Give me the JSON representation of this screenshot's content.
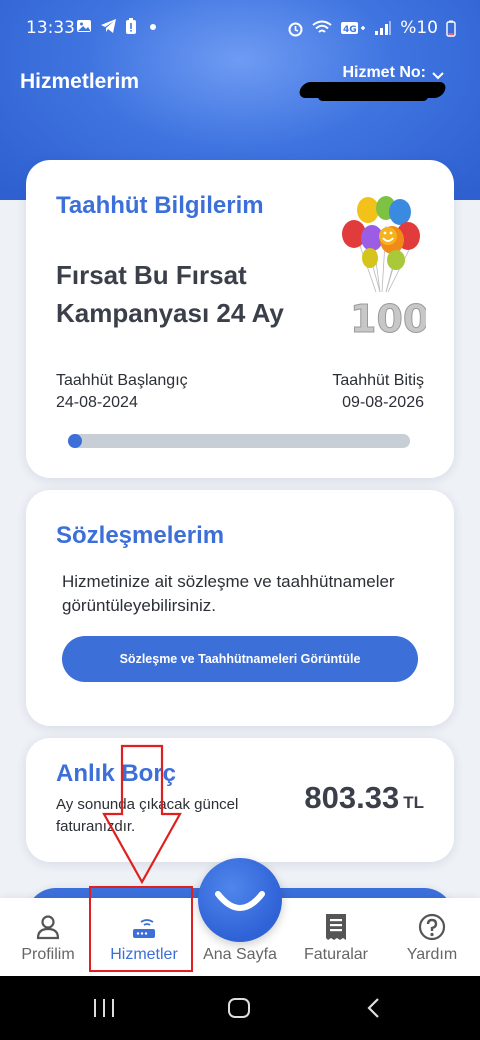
{
  "status_bar": {
    "time": "13:33",
    "battery_text": "%10",
    "left_icons": [
      "gallery-icon",
      "telegram-icon",
      "battery-alert-icon",
      "dot-icon"
    ],
    "right_icons": [
      "alarm-icon",
      "wifi-icon",
      "signal-icon"
    ]
  },
  "header": {
    "title": "Hizmetlerim",
    "service_no_label": "Hizmet No:"
  },
  "commitment": {
    "heading": "Taahhüt Bilgilerim",
    "campaign": "Fırsat Bu Fırsat Kampanyası 24 Ay",
    "start_label": "Taahhüt Başlangıç",
    "start_date": "24-08-2024",
    "end_label": "Taahhüt Bitiş",
    "end_date": "09-08-2026",
    "badge_text": "100",
    "progress_fraction": 0.04
  },
  "contracts": {
    "heading": "Sözleşmelerim",
    "description": "Hizmetinize ait sözleşme ve taahhütnameler görüntüleyebilirsiniz.",
    "button_label": "Sözleşme ve Taahhütnameleri Görüntüle"
  },
  "debt": {
    "heading": "Anlık Borç",
    "description": "Ay sonunda çıkacak güncel faturanızdır.",
    "amount": "803.33",
    "currency": "TL"
  },
  "bottom_nav": {
    "items": [
      {
        "label": "Profilim",
        "icon": "person-icon"
      },
      {
        "label": "Hizmetler",
        "icon": "router-icon",
        "active": true
      },
      {
        "label": "Ana Sayfa",
        "icon": "smile-icon"
      },
      {
        "label": "Faturalar",
        "icon": "receipt-icon"
      },
      {
        "label": "Yardım",
        "icon": "help-icon"
      }
    ]
  },
  "colors": {
    "accent": "#3c6fd8",
    "annotation": "#e02020"
  }
}
